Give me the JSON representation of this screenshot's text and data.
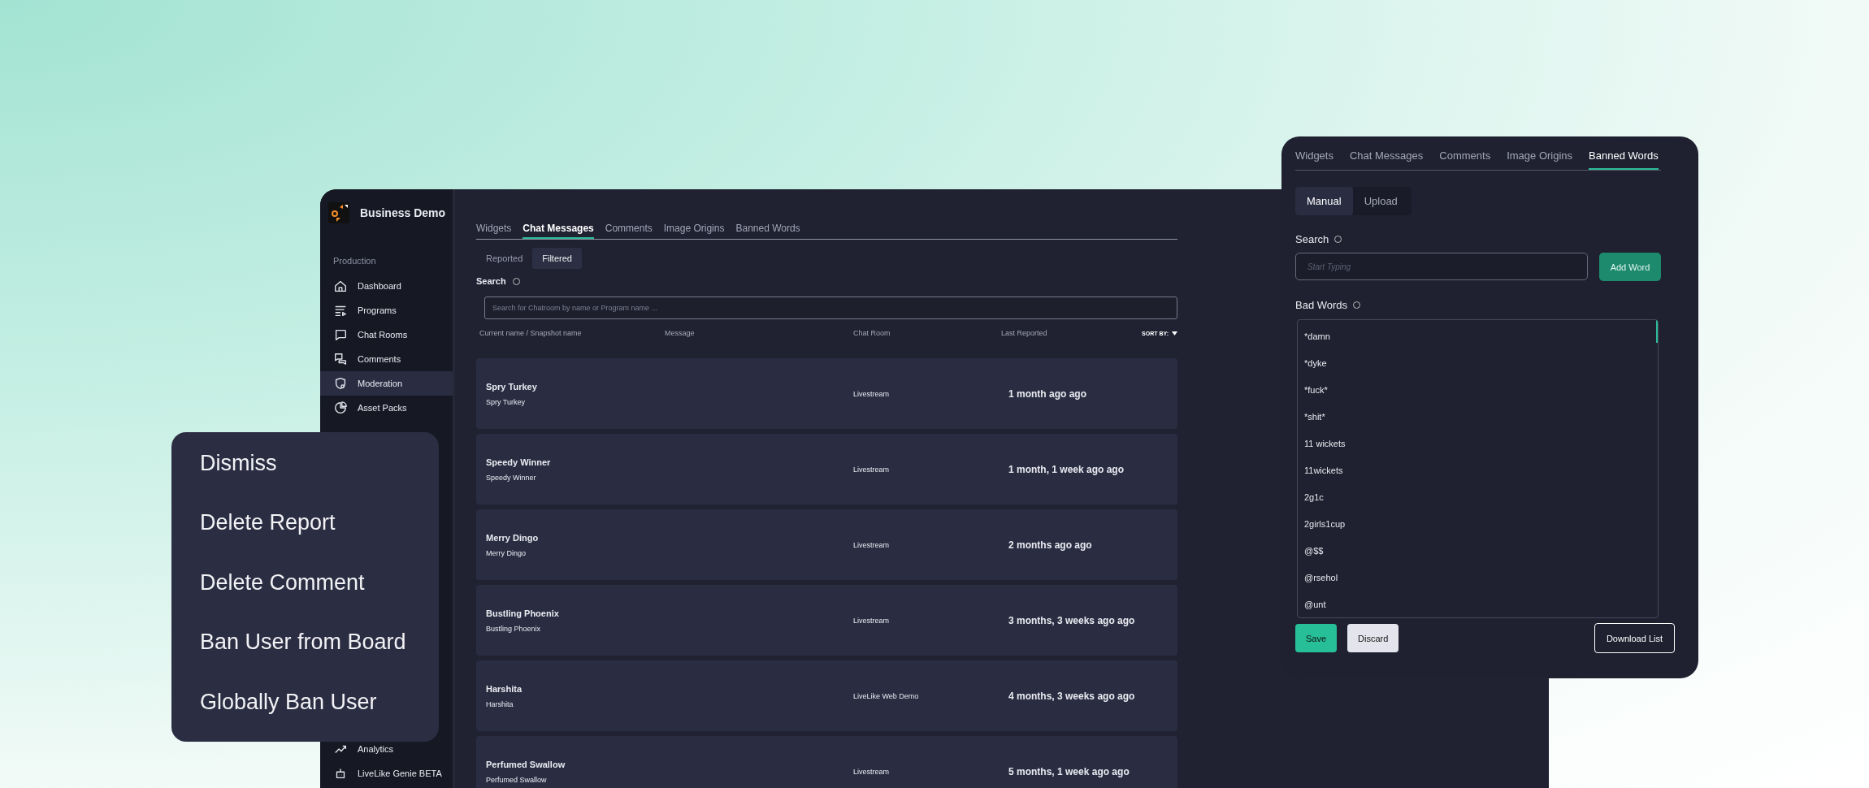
{
  "app": {
    "brand": "Business Demo",
    "sidebar": {
      "section": "Production",
      "items": [
        {
          "label": "Dashboard",
          "selected": false
        },
        {
          "label": "Programs",
          "selected": false
        },
        {
          "label": "Chat Rooms",
          "selected": false
        },
        {
          "label": "Comments",
          "selected": false
        },
        {
          "label": "Moderation",
          "selected": true
        },
        {
          "label": "Asset Packs",
          "selected": false
        }
      ],
      "bottom_items": [
        {
          "label": "Analytics",
          "selected": false
        },
        {
          "label": "LiveLike Genie BETA",
          "selected": false
        }
      ]
    },
    "tabs": [
      {
        "label": "Widgets",
        "selected": false
      },
      {
        "label": "Chat Messages",
        "selected": true
      },
      {
        "label": "Comments",
        "selected": false
      },
      {
        "label": "Image Origins",
        "selected": false
      },
      {
        "label": "Banned Words",
        "selected": false
      }
    ],
    "subtabs": [
      {
        "label": "Reported",
        "selected": false
      },
      {
        "label": "Filtered",
        "selected": true
      }
    ],
    "search": {
      "label": "Search",
      "placeholder": "Search for Chatroom by name or Program name ..."
    },
    "table": {
      "columns": [
        "Current name / Snapshot name",
        "Message",
        "Chat Room",
        "Last Reported"
      ],
      "sort_label": "SORT BY:",
      "rows": [
        {
          "name": "Spry Turkey",
          "snapshot": "Spry Turkey",
          "chat_room": "Livestream",
          "last_reported": "1 month ago ago"
        },
        {
          "name": "Speedy Winner",
          "snapshot": "Speedy Winner",
          "chat_room": "Livestream",
          "last_reported": "1 month, 1 week ago ago"
        },
        {
          "name": "Merry Dingo",
          "snapshot": "Merry Dingo",
          "chat_room": "Livestream",
          "last_reported": "2 months ago ago"
        },
        {
          "name": "Bustling Phoenix",
          "snapshot": "Bustling Phoenix",
          "chat_room": "Livestream",
          "last_reported": "3 months, 3 weeks ago ago"
        },
        {
          "name": "Harshita",
          "snapshot": "Harshita",
          "chat_room": "LiveLike Web Demo",
          "last_reported": "4 months, 3 weeks ago ago"
        },
        {
          "name": "Perfumed Swallow",
          "snapshot": "Perfumed Swallow",
          "chat_room": "Livestream",
          "last_reported": "5 months, 1 week ago ago"
        }
      ]
    }
  },
  "banned_words_panel": {
    "tabs": [
      {
        "label": "Widgets",
        "selected": false
      },
      {
        "label": "Chat Messages",
        "selected": false
      },
      {
        "label": "Comments",
        "selected": false
      },
      {
        "label": "Image Origins",
        "selected": false
      },
      {
        "label": "Banned Words",
        "selected": true
      }
    ],
    "mode_tabs": [
      {
        "label": "Manual",
        "selected": true
      },
      {
        "label": "Upload",
        "selected": false
      }
    ],
    "search": {
      "label": "Search",
      "placeholder": "Start Typing"
    },
    "add_button": {
      "label": "Add Word",
      "disabled": true
    },
    "list_label": "Bad Words",
    "words": [
      "*damn",
      "*dyke",
      "*fuck*",
      "*shit*",
      "11 wickets",
      "11wickets",
      "2g1c",
      "2girls1cup",
      "@$$",
      "@rsehol",
      "@unt"
    ],
    "buttons": {
      "save": "Save",
      "discard": "Discard",
      "download": "Download List"
    }
  },
  "context_menu": {
    "items": [
      "Dismiss",
      "Delete Report",
      "Delete Comment",
      "Ban User from Board",
      "Globally Ban User"
    ]
  }
}
